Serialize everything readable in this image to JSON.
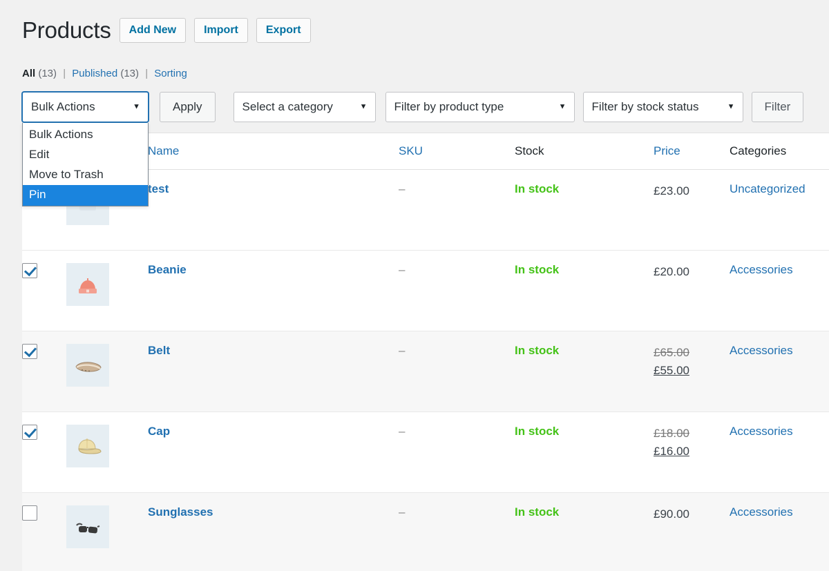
{
  "header": {
    "title": "Products",
    "buttons": [
      {
        "label": "Add New",
        "name": "add-new-button"
      },
      {
        "label": "Import",
        "name": "import-button"
      },
      {
        "label": "Export",
        "name": "export-button"
      }
    ]
  },
  "status_links": {
    "all_label": "All",
    "all_count": "(13)",
    "published_label": "Published",
    "published_count": "(13)",
    "sorting_label": "Sorting",
    "separator": "|"
  },
  "toolbar": {
    "bulk_actions_value": "Bulk Actions",
    "apply_label": "Apply",
    "category_value": "Select a category",
    "product_type_value": "Filter by product type",
    "stock_status_value": "Filter by stock status",
    "filter_label": "Filter",
    "caret": "▼"
  },
  "bulk_dropdown": {
    "open": true,
    "highlight_color": "#1a84de",
    "options": [
      {
        "label": "Bulk Actions",
        "selected": false
      },
      {
        "label": "Edit",
        "selected": false
      },
      {
        "label": "Move to Trash",
        "selected": false
      },
      {
        "label": "Pin",
        "selected": true
      }
    ]
  },
  "table": {
    "columns": [
      {
        "label": "",
        "type": "checkbox"
      },
      {
        "label": "",
        "type": "thumb"
      },
      {
        "label": "Name",
        "type": "link"
      },
      {
        "label": "SKU",
        "type": "link"
      },
      {
        "label": "Stock",
        "type": "plain"
      },
      {
        "label": "Price",
        "type": "link"
      },
      {
        "label": "Categories",
        "type": "plain"
      }
    ],
    "rows": [
      {
        "checked": true,
        "thumb": "product-thumbnail",
        "name": "test",
        "sku": "–",
        "stock": "In stock",
        "price": "£23.00",
        "sale_price": "",
        "category": "Uncategorized",
        "shade": "plain"
      },
      {
        "checked": true,
        "thumb": "beanie-thumbnail",
        "name": "Beanie",
        "sku": "–",
        "stock": "In stock",
        "price": "£20.00",
        "sale_price": "",
        "category": "Accessories",
        "shade": "plain"
      },
      {
        "checked": true,
        "thumb": "belt-thumbnail",
        "name": "Belt",
        "sku": "–",
        "stock": "In stock",
        "price": "£65.00",
        "sale_price": "£55.00",
        "category": "Accessories",
        "shade": "alt"
      },
      {
        "checked": true,
        "thumb": "cap-thumbnail",
        "name": "Cap",
        "sku": "–",
        "stock": "In stock",
        "price": "£18.00",
        "sale_price": "£16.00",
        "category": "Accessories",
        "shade": "plain"
      },
      {
        "checked": false,
        "thumb": "sunglasses-thumbnail",
        "name": "Sunglasses",
        "sku": "–",
        "stock": "In stock",
        "price": "£90.00",
        "sale_price": "",
        "category": "Accessories",
        "shade": "alt"
      }
    ]
  },
  "colors": {
    "page_background": "#f1f1f1",
    "link_blue": "#2271b1",
    "in_stock_green": "#44c217",
    "row_alt": "#f7f7f7",
    "thumb_background": "#e6eef3"
  }
}
